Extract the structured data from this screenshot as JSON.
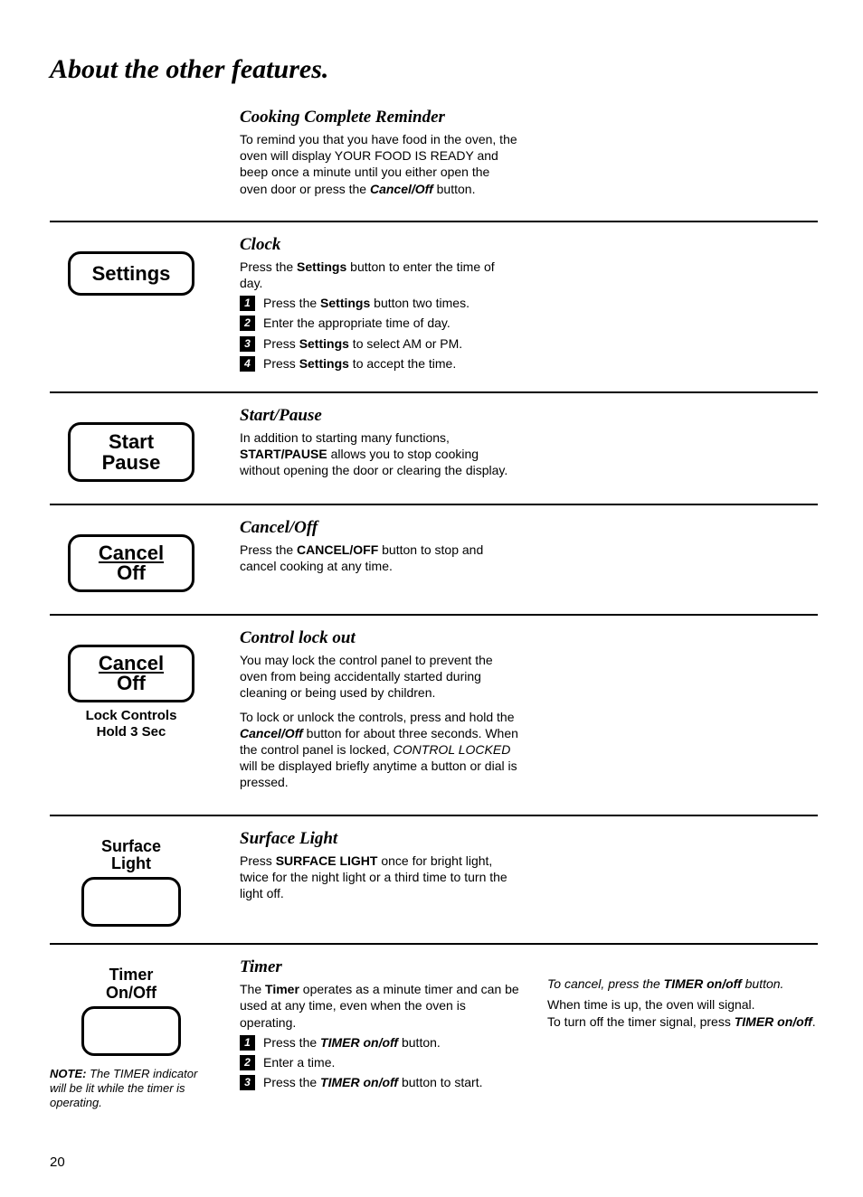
{
  "title": "About the other features.",
  "section_reminder": {
    "heading": "Cooking Complete Reminder",
    "text_a": "To remind you that you have food in the oven, the oven will display YOUR FOOD IS READY and beep once a minute until you either open the oven door or press the ",
    "btn": "Cancel/Off",
    "text_b": " button."
  },
  "section_clock": {
    "button": "Settings",
    "heading": "Clock",
    "intro_a": "Press the ",
    "intro_b": "Settings",
    "intro_c": " button to enter the time of day.",
    "steps": [
      {
        "a": "Press the ",
        "b": "Settings",
        "c": " button two times."
      },
      {
        "a": "Enter the appropriate time of day.",
        "b": "",
        "c": ""
      },
      {
        "a": "Press ",
        "b": "Settings",
        "c": " to select AM or PM."
      },
      {
        "a": "Press ",
        "b": "Settings",
        "c": " to accept the time."
      }
    ]
  },
  "section_startpause": {
    "button_line1": "Start",
    "button_line2": "Pause",
    "heading": "Start/Pause",
    "text_a": "In addition to starting many functions, ",
    "text_b": "START/PAUSE",
    "text_c": " allows you to stop cooking without opening the door or clearing the display."
  },
  "section_canceloff": {
    "button_line1": "Cancel",
    "button_line2": "Off",
    "heading": "Cancel/Off",
    "text_a": "Press the ",
    "text_b": "CANCEL/OFF",
    "text_c": " button to stop and cancel cooking at any time."
  },
  "section_lockout": {
    "button_line1": "Cancel",
    "button_line2": "Off",
    "caption_line1": "Lock Controls",
    "caption_line2": "Hold 3 Sec",
    "heading": "Control lock out",
    "p1": "You may lock the control panel to prevent the oven from being accidentally started during cleaning or being used by children.",
    "p2_a": "To lock or unlock the controls, press and hold the ",
    "p2_b": "Cancel/Off",
    "p2_c": " button for about three seconds. When the control panel is locked, ",
    "p2_d": "CONTROL LOCKED",
    "p2_e": " will be displayed briefly anytime a button or dial is pressed."
  },
  "section_surface": {
    "label_line1": "Surface",
    "label_line2": "Light",
    "heading": "Surface Light",
    "text_a": "Press ",
    "text_b": "SURFACE LIGHT",
    "text_c": " once for bright light, twice for the night light or a third time to turn the light off."
  },
  "section_timer": {
    "label_line1": "Timer",
    "label_line2": "On/Off",
    "note_a": "NOTE:",
    "note_b": " The TIMER indicator will be lit while the timer is operating.",
    "heading": "Timer",
    "intro_a": "The ",
    "intro_b": "Timer",
    "intro_c": " operates as a minute timer and can be used at any time, even when the oven is operating.",
    "steps": [
      {
        "a": "Press the ",
        "b": "TIMER on/off",
        "c": " button."
      },
      {
        "a": "Enter a time.",
        "b": "",
        "c": ""
      },
      {
        "a": "Press the ",
        "b": "TIMER on/off",
        "c": " button to start."
      }
    ],
    "right_a": "To cancel, press the ",
    "right_b": "TIMER on/off",
    "right_c": "  button.",
    "right_d": "When time is up, the oven will signal.",
    "right_e": "To turn off the timer signal, press ",
    "right_f": "TIMER on/off",
    "right_g": "."
  },
  "page_number": "20"
}
